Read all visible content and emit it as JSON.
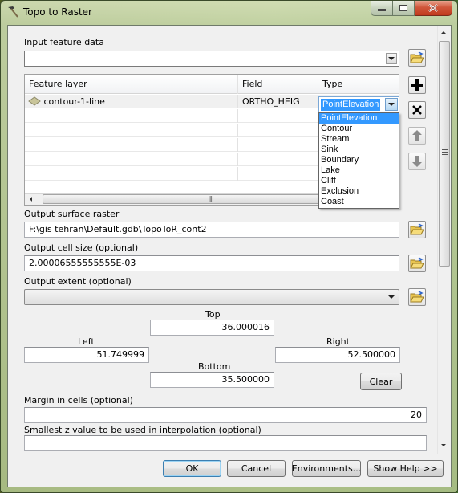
{
  "window": {
    "title": "Topo to Raster",
    "icon": "hammer-icon",
    "controls": {
      "minimize": "minimize-icon",
      "maximize": "maximize-icon",
      "close": "close-icon"
    }
  },
  "input_feature_data": {
    "label": "Input feature data",
    "value": "",
    "browse_icon": "open-folder-icon"
  },
  "feature_grid": {
    "columns": [
      "Feature layer",
      "Field",
      "Type"
    ],
    "rows": [
      {
        "feature_layer": "contour-1-line",
        "layer_icon": "polygon-layer-icon",
        "field": "ORTHO_HEIG",
        "type": "PointElevation"
      }
    ],
    "empty_rows": 5,
    "side_buttons": [
      {
        "name": "add",
        "icon": "plus-icon",
        "enabled": true
      },
      {
        "name": "remove",
        "icon": "x-icon",
        "enabled": true
      },
      {
        "name": "move-up",
        "icon": "arrow-up-icon",
        "enabled": false
      },
      {
        "name": "move-down",
        "icon": "arrow-down-icon",
        "enabled": false
      }
    ],
    "type_dropdown": {
      "selected": "PointElevation",
      "options": [
        "PointElevation",
        "Contour",
        "Stream",
        "Sink",
        "Boundary",
        "Lake",
        "Cliff",
        "Exclusion",
        "Coast"
      ]
    }
  },
  "output_surface_raster": {
    "label": "Output surface raster",
    "value": "F:\\gis tehran\\Default.gdb\\TopoToR_cont2"
  },
  "output_cell_size": {
    "label": "Output cell size (optional)",
    "value": "2.00006555555555E-03"
  },
  "output_extent": {
    "label": "Output extent (optional)",
    "value": "",
    "top_label": "Top",
    "top": "36.000016",
    "left_label": "Left",
    "left": "51.749999",
    "right_label": "Right",
    "right": "52.500000",
    "bottom_label": "Bottom",
    "bottom": "35.500000",
    "clear_label": "Clear"
  },
  "margin_in_cells": {
    "label": "Margin in cells (optional)",
    "value": "20"
  },
  "smallest_z": {
    "label": "Smallest z value to be used in interpolation (optional)",
    "value": ""
  },
  "footer": {
    "ok": "OK",
    "cancel": "Cancel",
    "environments": "Environments...",
    "show_help": "Show Help >>"
  },
  "colors": {
    "selection": "#3399ff",
    "dialog_bg": "#f0f0f0",
    "close_button": "#c8442a",
    "frame": "#c8d6ac"
  }
}
